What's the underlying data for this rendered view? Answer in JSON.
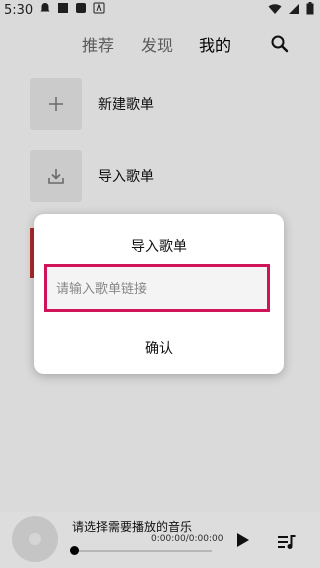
{
  "status": {
    "time": "5:30"
  },
  "nav": {
    "tabs": [
      "推荐",
      "发现",
      "我的"
    ]
  },
  "rows": {
    "new_playlist": "新建歌单",
    "import_playlist": "导入歌单"
  },
  "dialog": {
    "title": "导入歌单",
    "placeholder": "请输入歌单链接",
    "value": "",
    "confirm": "确认"
  },
  "player": {
    "title": "请选择需要播放的音乐",
    "time": "0:00:00/0:00:00",
    "progress": 0
  },
  "colors": {
    "accent": "#d0145a",
    "active_tab": "#000000",
    "inactive_tab": "#666666"
  },
  "icons": [
    "search-icon",
    "plus-icon",
    "download-icon",
    "play-icon",
    "queue-icon"
  ]
}
